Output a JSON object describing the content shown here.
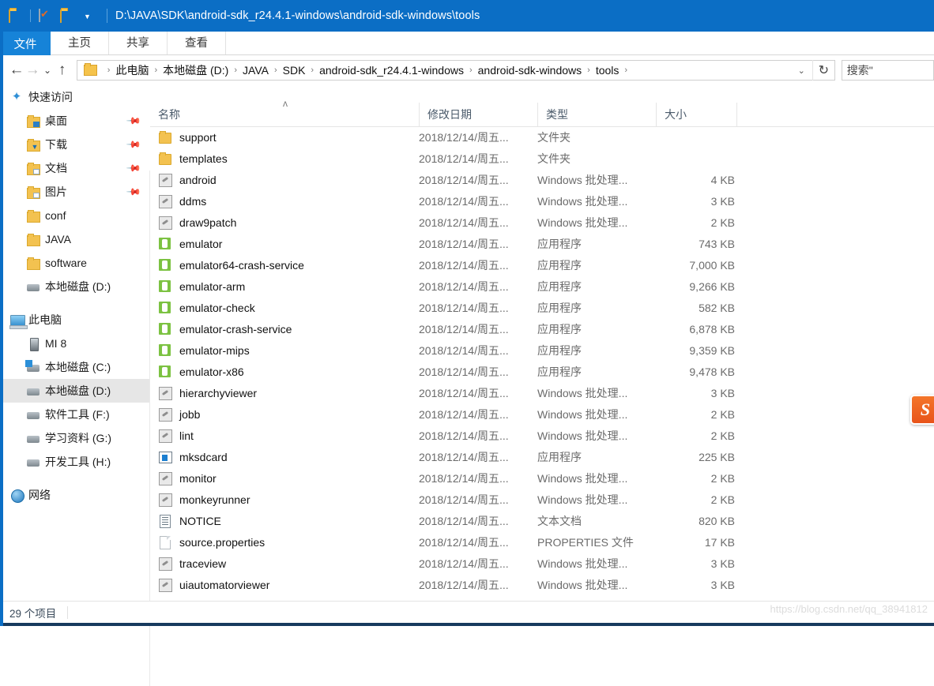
{
  "titlebar": {
    "path": "D:\\JAVA\\SDK\\android-sdk_r24.4.1-windows\\android-sdk-windows\\tools",
    "quick_access": [
      {
        "name": "folder-icon",
        "label": ""
      },
      {
        "name": "properties-icon",
        "label": ""
      },
      {
        "name": "new-folder-icon",
        "label": ""
      },
      {
        "name": "chevron-down-icon",
        "label": "▾"
      }
    ],
    "accent_color": "#0b6ec5"
  },
  "ribbon": {
    "tabs": [
      {
        "label": "文件",
        "active": true
      },
      {
        "label": "主页",
        "active": false
      },
      {
        "label": "共享",
        "active": false
      },
      {
        "label": "查看",
        "active": false
      }
    ]
  },
  "addressbar": {
    "back": "←",
    "forward": "→",
    "recent": "⌄",
    "up": "↑",
    "dropdown": "⌄",
    "refresh": "↻",
    "crumbs": [
      "此电脑",
      "本地磁盘 (D:)",
      "JAVA",
      "SDK",
      "android-sdk_r24.4.1-windows",
      "android-sdk-windows",
      "tools"
    ],
    "separator": "›",
    "search_text": "搜索\""
  },
  "sidebar": {
    "groups": [
      {
        "name": "quick-access",
        "label": "快速访问",
        "icon": "star-icon",
        "items": [
          {
            "label": "桌面",
            "icon": "folder-desktop-icon",
            "pinned": true
          },
          {
            "label": "下载",
            "icon": "folder-downloads-icon",
            "pinned": true
          },
          {
            "label": "文档",
            "icon": "folder-documents-icon",
            "pinned": true
          },
          {
            "label": "图片",
            "icon": "folder-pictures-icon",
            "pinned": true
          },
          {
            "label": "conf",
            "icon": "folder-icon",
            "pinned": false
          },
          {
            "label": "JAVA",
            "icon": "folder-icon",
            "pinned": false
          },
          {
            "label": "software",
            "icon": "folder-icon",
            "pinned": false
          },
          {
            "label": "本地磁盘 (D:)",
            "icon": "drive-icon",
            "pinned": false
          }
        ]
      },
      {
        "name": "this-pc",
        "label": "此电脑",
        "icon": "computer-icon",
        "items": [
          {
            "label": "MI 8",
            "icon": "phone-icon",
            "pinned": false,
            "selected": false
          },
          {
            "label": "本地磁盘 (C:)",
            "icon": "windows-drive-icon",
            "pinned": false,
            "selected": false
          },
          {
            "label": "本地磁盘 (D:)",
            "icon": "drive-icon",
            "pinned": false,
            "selected": true
          },
          {
            "label": "软件工具 (F:)",
            "icon": "drive-icon",
            "pinned": false,
            "selected": false
          },
          {
            "label": "学习资料 (G:)",
            "icon": "drive-icon",
            "pinned": false,
            "selected": false
          },
          {
            "label": "开发工具 (H:)",
            "icon": "drive-icon",
            "pinned": false,
            "selected": false
          }
        ]
      },
      {
        "name": "network",
        "label": "网络",
        "icon": "network-icon",
        "items": []
      }
    ]
  },
  "filelist": {
    "columns": [
      {
        "label": "名称",
        "sorted": "asc",
        "sort_glyph": "ʌ"
      },
      {
        "label": "修改日期",
        "sorted": null
      },
      {
        "label": "类型",
        "sorted": null
      },
      {
        "label": "大小",
        "sorted": null
      }
    ],
    "rows": [
      {
        "name": "support",
        "icon": "folder-icon",
        "date": "2018/12/14/周五...",
        "type": "文件夹",
        "size": ""
      },
      {
        "name": "templates",
        "icon": "folder-icon",
        "date": "2018/12/14/周五...",
        "type": "文件夹",
        "size": ""
      },
      {
        "name": "android",
        "icon": "batch-icon",
        "date": "2018/12/14/周五...",
        "type": "Windows 批处理...",
        "size": "4 KB"
      },
      {
        "name": "ddms",
        "icon": "batch-icon",
        "date": "2018/12/14/周五...",
        "type": "Windows 批处理...",
        "size": "3 KB"
      },
      {
        "name": "draw9patch",
        "icon": "batch-icon",
        "date": "2018/12/14/周五...",
        "type": "Windows 批处理...",
        "size": "2 KB"
      },
      {
        "name": "emulator",
        "icon": "exe-icon",
        "date": "2018/12/14/周五...",
        "type": "应用程序",
        "size": "743 KB"
      },
      {
        "name": "emulator64-crash-service",
        "icon": "exe-icon",
        "date": "2018/12/14/周五...",
        "type": "应用程序",
        "size": "7,000 KB"
      },
      {
        "name": "emulator-arm",
        "icon": "exe-icon",
        "date": "2018/12/14/周五...",
        "type": "应用程序",
        "size": "9,266 KB"
      },
      {
        "name": "emulator-check",
        "icon": "exe-icon",
        "date": "2018/12/14/周五...",
        "type": "应用程序",
        "size": "582 KB"
      },
      {
        "name": "emulator-crash-service",
        "icon": "exe-icon",
        "date": "2018/12/14/周五...",
        "type": "应用程序",
        "size": "6,878 KB"
      },
      {
        "name": "emulator-mips",
        "icon": "exe-icon",
        "date": "2018/12/14/周五...",
        "type": "应用程序",
        "size": "9,359 KB"
      },
      {
        "name": "emulator-x86",
        "icon": "exe-icon",
        "date": "2018/12/14/周五...",
        "type": "应用程序",
        "size": "9,478 KB"
      },
      {
        "name": "hierarchyviewer",
        "icon": "batch-icon",
        "date": "2018/12/14/周五...",
        "type": "Windows 批处理...",
        "size": "3 KB"
      },
      {
        "name": "jobb",
        "icon": "batch-icon",
        "date": "2018/12/14/周五...",
        "type": "Windows 批处理...",
        "size": "2 KB"
      },
      {
        "name": "lint",
        "icon": "batch-icon",
        "date": "2018/12/14/周五...",
        "type": "Windows 批处理...",
        "size": "2 KB"
      },
      {
        "name": "mksdcard",
        "icon": "window-app-icon",
        "date": "2018/12/14/周五...",
        "type": "应用程序",
        "size": "225 KB"
      },
      {
        "name": "monitor",
        "icon": "batch-icon",
        "date": "2018/12/14/周五...",
        "type": "Windows 批处理...",
        "size": "2 KB"
      },
      {
        "name": "monkeyrunner",
        "icon": "batch-icon",
        "date": "2018/12/14/周五...",
        "type": "Windows 批处理...",
        "size": "2 KB"
      },
      {
        "name": "NOTICE",
        "icon": "text-file-icon",
        "date": "2018/12/14/周五...",
        "type": "文本文档",
        "size": "820 KB"
      },
      {
        "name": "source.properties",
        "icon": "plain-file-icon",
        "date": "2018/12/14/周五...",
        "type": "PROPERTIES 文件",
        "size": "17 KB"
      },
      {
        "name": "traceview",
        "icon": "batch-icon",
        "date": "2018/12/14/周五...",
        "type": "Windows 批处理...",
        "size": "3 KB"
      },
      {
        "name": "uiautomatorviewer",
        "icon": "batch-icon",
        "date": "2018/12/14/周五...",
        "type": "Windows 批处理...",
        "size": "3 KB"
      }
    ]
  },
  "statusbar": {
    "item_count": "29 个项目"
  },
  "overlays": {
    "watermark": "https://blog.csdn.net/qq_38941812",
    "ime_badge": "S"
  }
}
